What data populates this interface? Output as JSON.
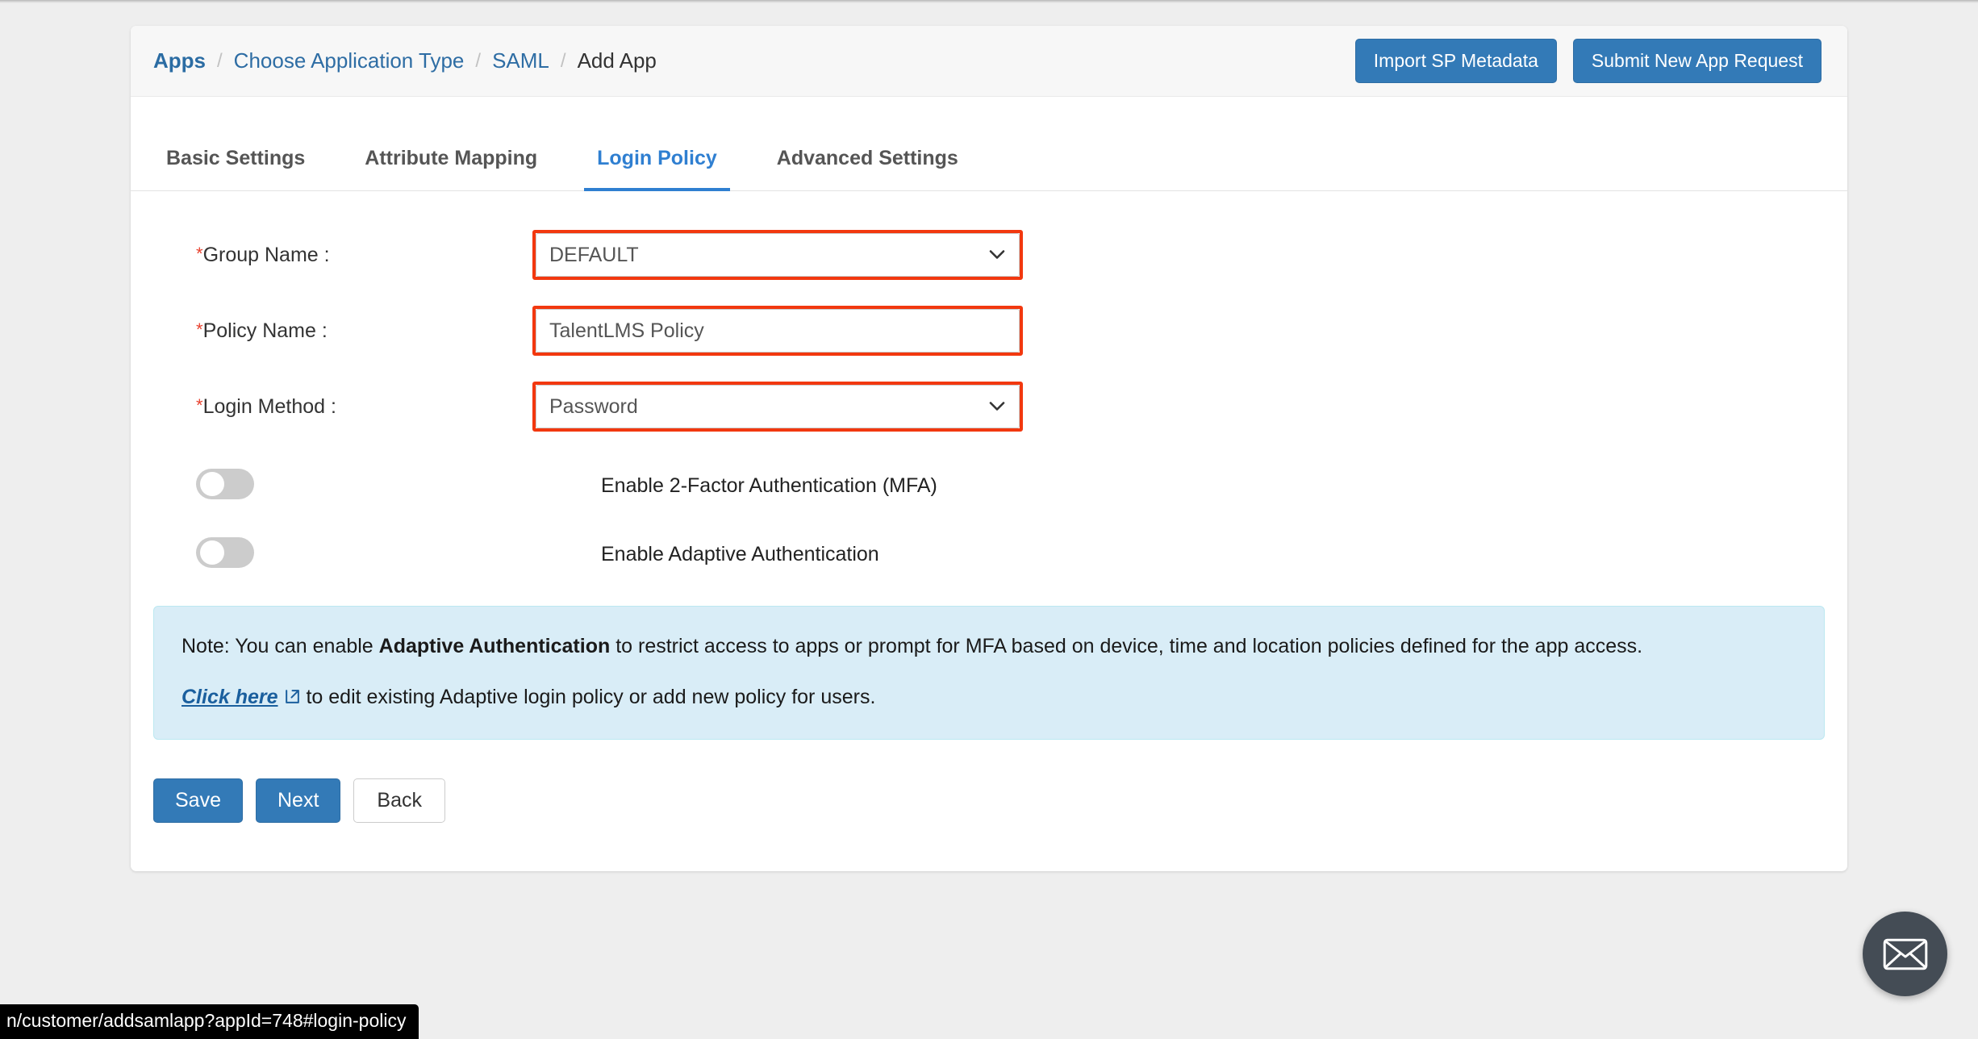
{
  "breadcrumb": {
    "items": [
      {
        "label": "Apps",
        "type": "link-strong"
      },
      {
        "label": "Choose Application Type",
        "type": "link"
      },
      {
        "label": "SAML",
        "type": "link"
      },
      {
        "label": "Add App",
        "type": "current"
      }
    ],
    "separator": "/"
  },
  "header": {
    "import_metadata_label": "Import SP Metadata",
    "submit_request_label": "Submit New App Request",
    "primary_color": "#337ab7"
  },
  "tabs": [
    {
      "label": "Basic Settings",
      "active": false
    },
    {
      "label": "Attribute Mapping",
      "active": false
    },
    {
      "label": "Login Policy",
      "active": true
    },
    {
      "label": "Advanced Settings",
      "active": false
    }
  ],
  "tab_active_color": "#2f7fd1",
  "form": {
    "highlight_color": "#f2380f",
    "required_marker": "*",
    "group_name": {
      "label": "Group Name :",
      "value": "DEFAULT",
      "options": [
        "DEFAULT"
      ]
    },
    "policy_name": {
      "label": "Policy Name :",
      "value": "TalentLMS Policy",
      "placeholder": ""
    },
    "login_method": {
      "label": "Login Method :",
      "value": "Password",
      "options": [
        "Password"
      ]
    },
    "toggles": [
      {
        "label": "Enable 2-Factor Authentication (MFA)",
        "on": false
      },
      {
        "label": "Enable Adaptive Authentication",
        "on": false
      }
    ]
  },
  "note": {
    "background_color": "#d9edf7",
    "line1_prefix": "Note: You can enable ",
    "line1_bold": "Adaptive Authentication",
    "line1_suffix": " to restrict access to apps or prompt for MFA based on device, time and location policies defined for the app access.",
    "link_label": "Click here",
    "line2_suffix": " to edit existing Adaptive login policy or add new policy for users."
  },
  "actions": {
    "save_label": "Save",
    "next_label": "Next",
    "back_label": "Back"
  },
  "fab": {
    "icon": "mail-icon",
    "color": "#444c55"
  },
  "status_bar": {
    "url": "n/customer/addsamlapp?appId=748#login-policy"
  }
}
